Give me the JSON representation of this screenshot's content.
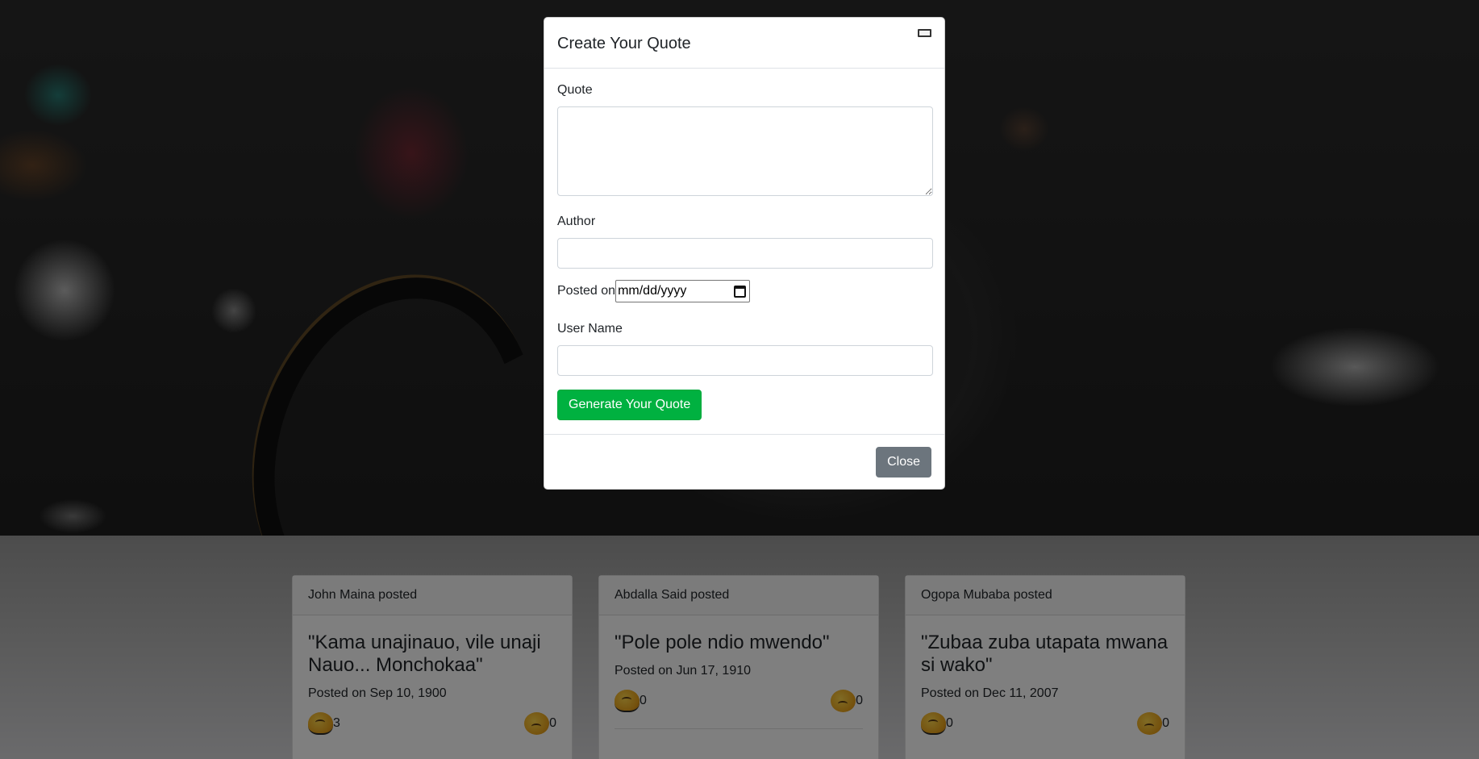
{
  "modal": {
    "title": "Create Your Quote",
    "close_icon": "minimize-close-icon",
    "quote_label": "Quote",
    "quote_value": "",
    "author_label": "Author",
    "author_value": "",
    "posted_label": "Posted on",
    "date_placeholder": "mm/dd/yyyy",
    "username_label": "User Name",
    "username_value": "",
    "submit_label": "Generate Your Quote",
    "close_label": "Close"
  },
  "colors": {
    "primary_button": "#00b140",
    "secondary_button": "#6c757d"
  },
  "cards": [
    {
      "header": "John Maina posted",
      "quote": "\"Kama unajinauo, vile unaji Nauo... Monchokaa\"",
      "date": "Posted on Sep 10, 1900",
      "likes": "3",
      "dislikes": "0"
    },
    {
      "header": "Abdalla Said posted",
      "quote": "\"Pole pole ndio mwendo\"",
      "date": "Posted on Jun 17, 1910",
      "likes": "0",
      "dislikes": "0"
    },
    {
      "header": "Ogopa Mubaba posted",
      "quote": "\"Zubaa zuba utapata mwana si wako\"",
      "date": "Posted on Dec 11, 2007",
      "likes": "0",
      "dislikes": "0"
    }
  ]
}
